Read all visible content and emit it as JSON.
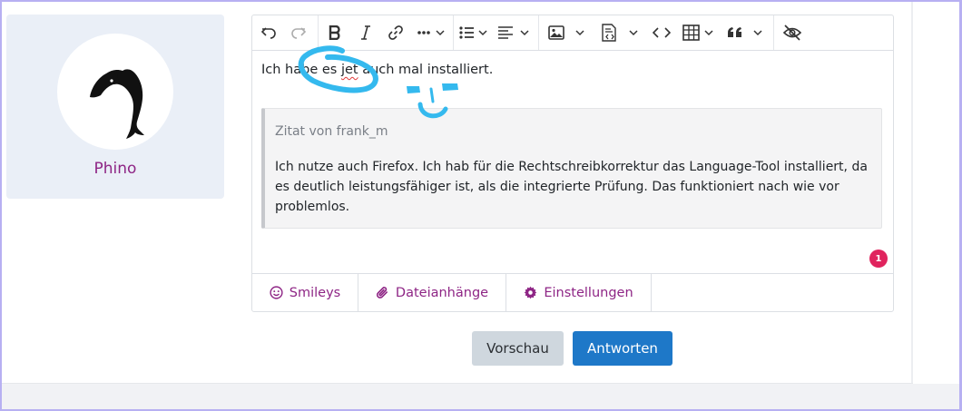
{
  "user": {
    "name": "Phino",
    "avatar_icon": "dolphin-icon"
  },
  "toolbar": {
    "buttons": [
      "undo-icon",
      "redo-icon",
      "bold-icon",
      "italic-icon",
      "link-icon",
      "more-formatting-icon",
      "list-icon",
      "align-icon",
      "image-icon",
      "insert-media-icon",
      "code-icon",
      "table-icon",
      "quote-icon",
      "preview-toggle-icon"
    ]
  },
  "editor": {
    "text_before": "Ich habe es ",
    "text_misspelled": "jet",
    "text_after": " auch mal installiert.",
    "quote": {
      "header": "Zitat von frank_m",
      "body": "Ich nutze auch Firefox. Ich hab für die Rechtschreibkorrektur das Language-Tool installiert, da es deutlich leistungsfähiger ist, als die integrierte Prüfung. Das funktioniert nach wie vor problemlos."
    },
    "spellcheck_badge": "1"
  },
  "bottombar": {
    "smileys": "Smileys",
    "attachments": "Dateianhänge",
    "settings": "Einstellungen"
  },
  "actions": {
    "preview": "Vorschau",
    "reply": "Antworten"
  },
  "colors": {
    "accent": "#8e2585",
    "primary": "#1e78c8",
    "annotation": "#34b9ee",
    "badge": "#e0245e"
  }
}
